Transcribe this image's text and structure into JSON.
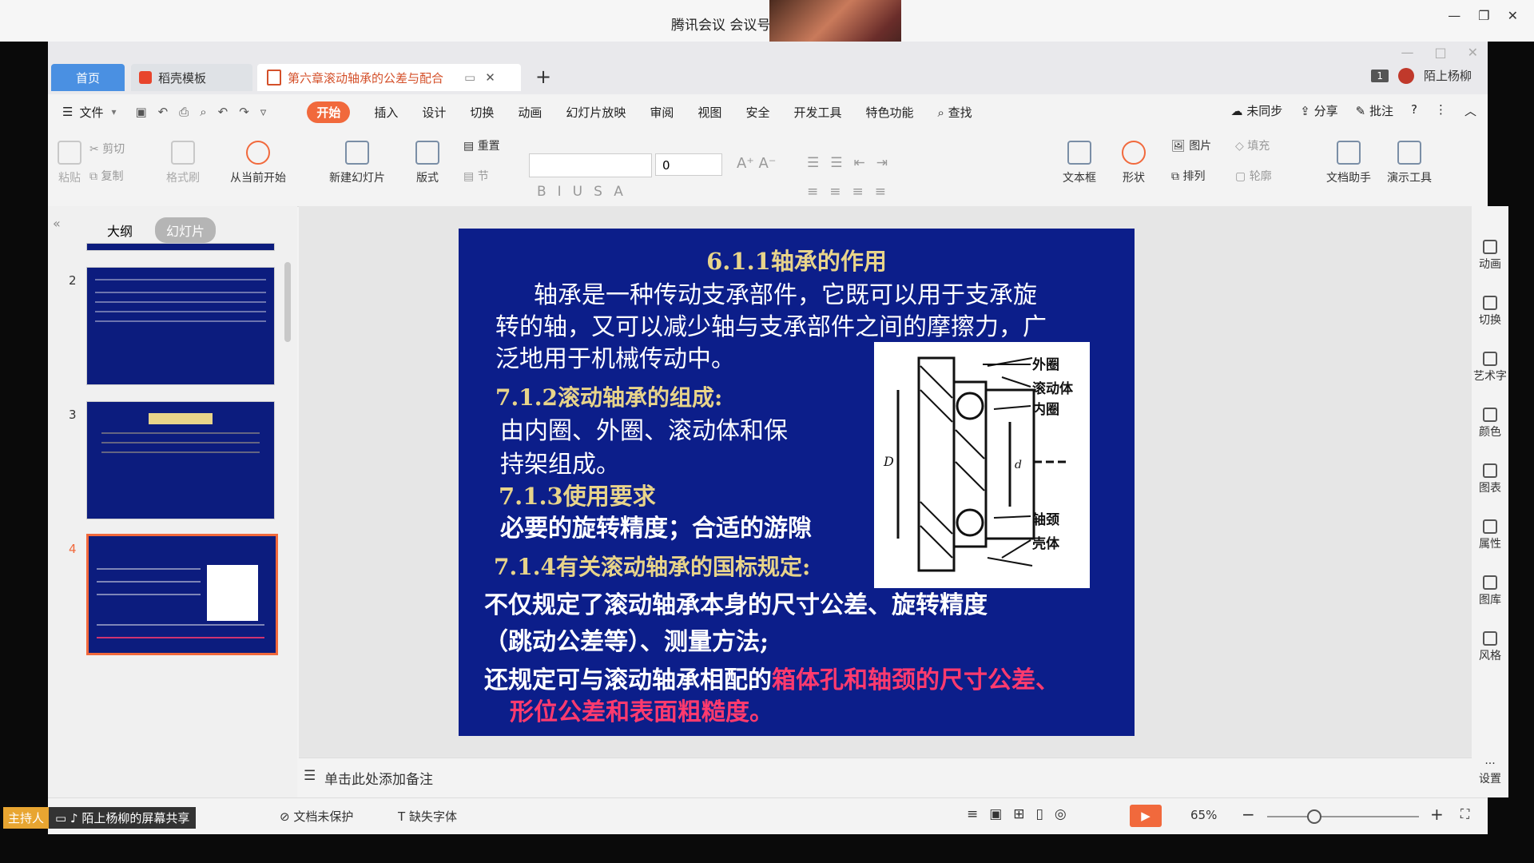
{
  "meeting": {
    "title": "腾讯会议 会议号",
    "host_label": "主持人",
    "share_label": "陌上杨柳的屏幕共享"
  },
  "tabs": {
    "home": "首页",
    "template": "稻壳模板",
    "doc": "第六章滚动轴承的公差与配合",
    "user": "陌上杨柳",
    "badge": "1"
  },
  "menu": {
    "file": "文件",
    "items": [
      "开始",
      "插入",
      "设计",
      "切换",
      "动画",
      "幻灯片放映",
      "审阅",
      "视图",
      "安全",
      "开发工具",
      "特色功能"
    ],
    "search": "查找",
    "sync": "未同步",
    "share": "分享",
    "comment": "批注"
  },
  "ribbon": {
    "paste": "粘贴",
    "cut": "剪切",
    "copy": "复制",
    "format_painter": "格式刷",
    "from_current": "从当前开始",
    "new_slide": "新建幻灯片",
    "layout": "版式",
    "reset": "重置",
    "section": "节",
    "font_size": "0",
    "textbox": "文本框",
    "shape": "形状",
    "image": "图片",
    "fill": "填充",
    "arrange": "排列",
    "outline": "轮廓",
    "doc_helper": "文档助手",
    "present_tools": "演示工具"
  },
  "pane": {
    "outline": "大纲",
    "slides": "幻灯片",
    "numbers": [
      "2",
      "3",
      "4"
    ]
  },
  "slide": {
    "title": "6.1.1轴承的作用",
    "p1_l1": "轴承是一种传动支承部件，它既可以用于支承旋",
    "p1_l2": "转的轴，又可以减少轴与支承部件之间的摩擦力，广",
    "p1_l3": "泛地用于机械传动中。",
    "h2": "7.1.2滚动轴承的组成:",
    "p2_l1": "由内圈、外圈、滚动体和保",
    "p2_l2": "持架组成。",
    "h3": "7.1.3使用要求",
    "p3": "必要的旋转精度；合适的游隙",
    "h4": "7.1.4有关滚动轴承的国标规定:",
    "p4_l1": "不仅规定了滚动轴承本身的尺寸公差、旋转精度",
    "p4_l2": "（跳动公差等）、测量方法;",
    "p5_a": "还规定可与滚动轴承相配的",
    "p5_b": "箱体孔和轴颈的尺寸公差、",
    "p5_c": "形位公差和表面粗糙度。",
    "fig": {
      "outer": "外圈",
      "roller": "滚动体",
      "inner": "内圈",
      "journal": "轴颈",
      "housing": "壳体",
      "D": "D",
      "d": "d"
    },
    "colors": {
      "bg": "#0c1e8a",
      "heading": "#e8d48a",
      "body": "#ffffff",
      "highlight": "#ff3a6e"
    }
  },
  "notes": "单击此处添加备注",
  "status": {
    "unprotected": "文档未保护",
    "missing_font": "缺失字体",
    "zoom": "65%"
  },
  "sidebar": [
    "动画",
    "切换",
    "艺术字",
    "颜色",
    "图表",
    "属性",
    "图库",
    "风格",
    "设置"
  ]
}
